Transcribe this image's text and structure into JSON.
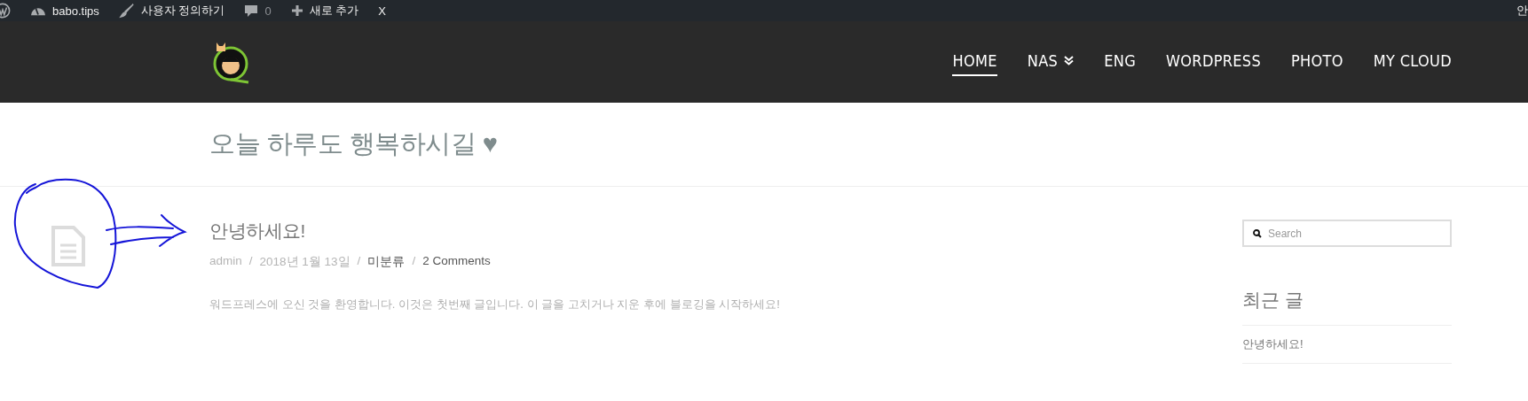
{
  "admin_bar": {
    "items": [
      {
        "kind": "wp"
      },
      {
        "kind": "site",
        "label": "babo.tips"
      },
      {
        "kind": "customize",
        "label": "사용자 정의하기"
      },
      {
        "kind": "comments",
        "label": "0"
      },
      {
        "kind": "new",
        "label": "새로 추가"
      },
      {
        "kind": "text",
        "label": "X"
      }
    ],
    "account": "안"
  },
  "nav": {
    "items": [
      {
        "label": "HOME",
        "selected": true,
        "has_submenu": false
      },
      {
        "label": "NAS",
        "selected": false,
        "has_submenu": true
      },
      {
        "label": "ENG",
        "selected": false,
        "has_submenu": false
      },
      {
        "label": "WORDPRESS",
        "selected": false,
        "has_submenu": false
      },
      {
        "label": "PHOTO",
        "selected": false,
        "has_submenu": false
      },
      {
        "label": "MY CLOUD",
        "selected": false,
        "has_submenu": false
      }
    ]
  },
  "page_title": "오늘 하루도 행복하시길 ♥",
  "post": {
    "title": "안녕하세요!",
    "meta": [
      {
        "kind": "author",
        "text": "admin"
      },
      {
        "kind": "separator",
        "text": "/"
      },
      {
        "kind": "date",
        "text": "2018년 1월 13일"
      },
      {
        "kind": "separator",
        "text": "/"
      },
      {
        "kind": "category",
        "text": "미분류"
      },
      {
        "kind": "separator",
        "text": "/"
      },
      {
        "kind": "comments",
        "text": "2 Comments"
      }
    ],
    "excerpt": "워드프레스에 오신 것을 환영합니다. 이것은 첫번째 글입니다. 이 글을 고치거나 지운 후에 블로깅을 시작하세요!"
  },
  "sidebar": {
    "search": {
      "placeholder": "Search"
    },
    "recent_title": "최근 글",
    "recent": [
      "안녕하세요!"
    ]
  }
}
